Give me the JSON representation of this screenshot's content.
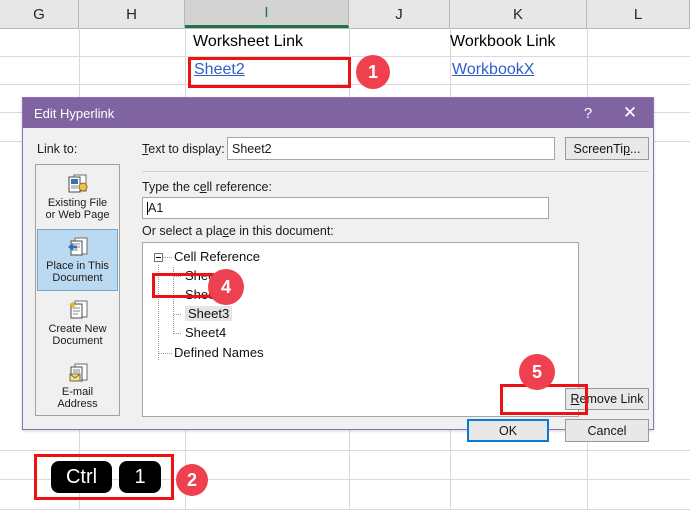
{
  "spreadsheet": {
    "column_headers": [
      "G",
      "H",
      "I",
      "J",
      "K",
      "L"
    ],
    "active_column": "I",
    "cells": {
      "worksheet_link_header": "Worksheet Link",
      "worksheet_link_value": "Sheet2",
      "workbook_link_header": "Workbook Link",
      "workbook_link_value": "WorkbookX"
    }
  },
  "markers": {
    "one": "1",
    "two": "2",
    "four": "4",
    "five": "5"
  },
  "keyboard": {
    "key1": "Ctrl",
    "key2": "1"
  },
  "dialog": {
    "title": "Edit Hyperlink",
    "help_icon": "?",
    "close_icon": "✕",
    "link_to_label": "Link to:",
    "sidebar": [
      {
        "label_line1": "Existing File",
        "label_line2": "or Web Page",
        "icon": "existing-file-icon",
        "selected": false
      },
      {
        "label_line1": "Place in This",
        "label_line2": "Document",
        "icon": "place-in-document-icon",
        "selected": true
      },
      {
        "label_line1": "Create New",
        "label_line2": "Document",
        "icon": "create-new-document-icon",
        "selected": false
      },
      {
        "label_line1": "E-mail",
        "label_line2": "Address",
        "icon": "email-address-icon",
        "selected": false
      }
    ],
    "text_to_display_label": "Text to display:",
    "text_to_display_value": "Sheet2",
    "screentip_button": "ScreenTip...",
    "cell_reference_label": "Type the cell reference:",
    "cell_reference_value": "A1",
    "select_place_label": "Or select a place in this document:",
    "tree": {
      "root": "Cell Reference",
      "sheets": [
        "Sheet1",
        "Sheet2",
        "Sheet3",
        "Sheet4"
      ],
      "selected_sheet": "Sheet3",
      "defined_names": "Defined Names"
    },
    "remove_link_button": "Remove Link",
    "ok_button": "OK",
    "cancel_button": "Cancel"
  },
  "colors": {
    "dialog_title_bar": "#8064a2",
    "annotation_red": "#ee1111",
    "marker_red": "#ef4050",
    "excel_green": "#217346",
    "hyperlink_blue": "#2f5fc9",
    "selection_blue": "#bcd9f2",
    "focus_blue": "#0a7ad4"
  }
}
